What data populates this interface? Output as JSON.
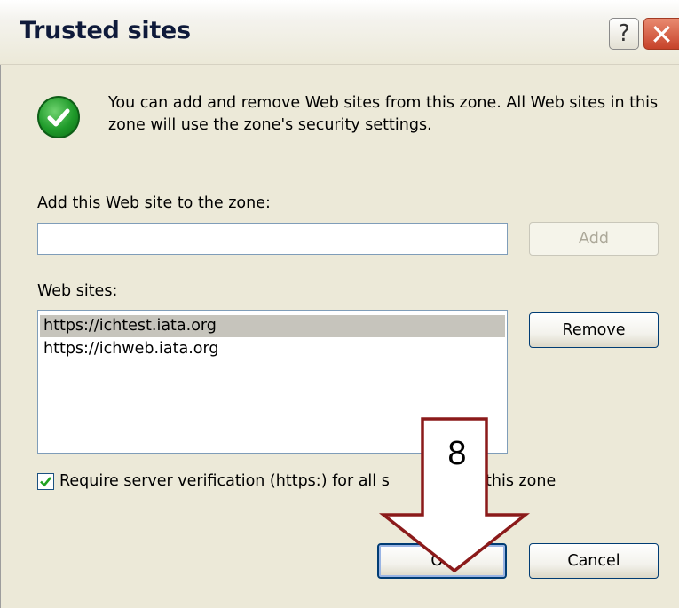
{
  "window": {
    "title": "Trusted sites",
    "help_glyph": "?",
    "close_glyph": "✕"
  },
  "info": {
    "icon": "green-check-icon",
    "description": "You can add and remove Web sites from this zone. All Web sites in this zone will use the zone's security settings."
  },
  "add_site": {
    "label": "Add this Web site to the zone:",
    "input_value": "",
    "add_button": "Add"
  },
  "web_sites": {
    "label": "Web sites:",
    "items": [
      {
        "url": "https://ichtest.iata.org",
        "selected": true
      },
      {
        "url": "https://ichweb.iata.org",
        "selected": false
      }
    ],
    "remove_button": "Remove"
  },
  "require_verification": {
    "checked": true,
    "label_part1": "Require server verification (https:) for all s",
    "label_part2": "this zone"
  },
  "footer": {
    "ok_button": "OK",
    "cancel_button": "Cancel"
  },
  "annotation": {
    "step_number": "8",
    "color": "#8b1a1a"
  }
}
